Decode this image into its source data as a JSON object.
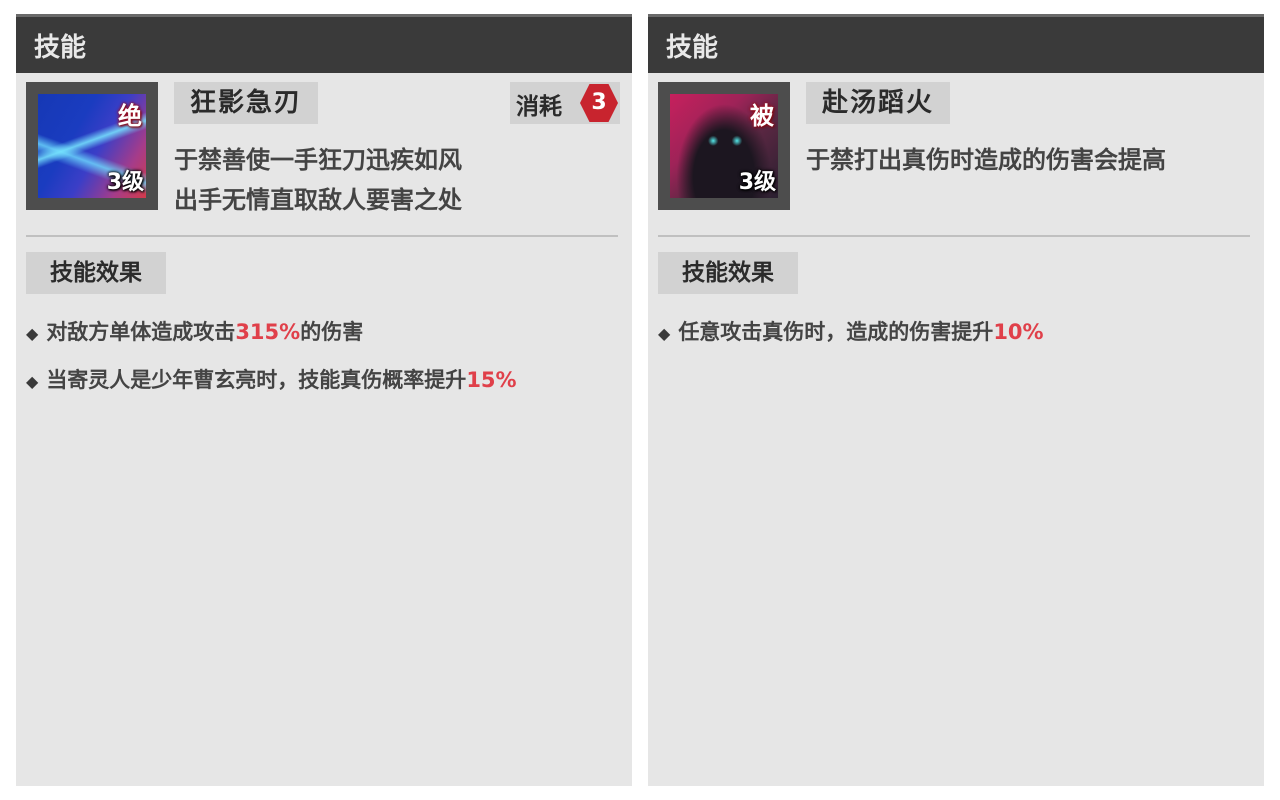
{
  "panels": [
    {
      "title": "技能",
      "skill": {
        "name": "狂影急刃",
        "type_badge": "绝",
        "level": "3级",
        "description": [
          "于禁善使一手狂刀迅疾如风",
          "出手无情直取敌人要害之处"
        ],
        "cost": {
          "label": "消耗",
          "value": "3"
        }
      },
      "effects_header": "技能效果",
      "effects": [
        {
          "prefix": "对敌方单体造成攻击",
          "highlight": "315%",
          "suffix": "的伤害"
        },
        {
          "prefix": "当寄灵人是少年曹玄亮时，技能真伤概率提升",
          "highlight": "15%",
          "suffix": ""
        }
      ]
    },
    {
      "title": "技能",
      "skill": {
        "name": "赴汤蹈火",
        "type_badge": "被",
        "level": "3级",
        "description": [
          "于禁打出真伤时造成的伤害会提高"
        ]
      },
      "effects_header": "技能效果",
      "effects": [
        {
          "prefix": "任意攻击真伤时，造成的伤害提升",
          "highlight": "10%",
          "suffix": ""
        }
      ]
    }
  ],
  "colors": {
    "highlight": "#e0404a",
    "header_bg": "#3a3a3a",
    "panel_bg": "#e6e6e6",
    "cost_gem": "#c8242e"
  },
  "icons": {
    "bullet": "◆",
    "left_skill_art": "blue-slash-art",
    "right_skill_art": "crimson-hooded-figure-art",
    "cost_gem": "red-hexagon-gem"
  }
}
